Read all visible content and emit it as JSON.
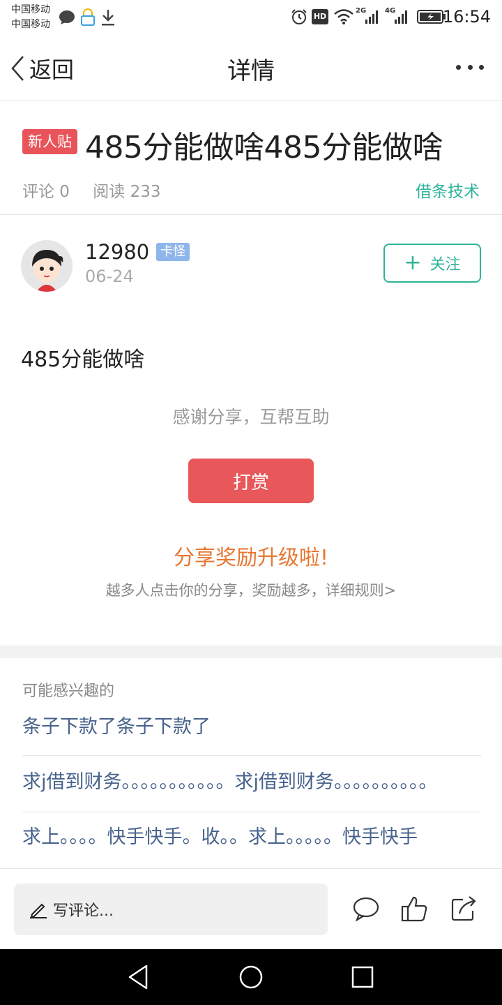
{
  "status_bar": {
    "carrier_1": "中国移动",
    "carrier_2": "中国移动",
    "signal_2g": "2G",
    "signal_4g": "4G",
    "hd_label": "HD",
    "time": "16:54"
  },
  "nav": {
    "back_label": "返回",
    "title": "详情"
  },
  "post": {
    "badge": "新人贴",
    "title": "485分能做啥485分能做啥",
    "comments_label": "评论 0",
    "reads_label": "阅读 233",
    "category": "借条技术",
    "author_name": "12980",
    "author_tag": "卡怪",
    "date": "06-24",
    "follow_plus": "+",
    "follow_label": "关注",
    "body": "485分能做啥",
    "thanks": "感谢分享，互帮互助",
    "reward_label": "打赏",
    "share_title": "分享奖励升级啦!",
    "share_desc": "越多人点击你的分享，奖励越多，详细规则>"
  },
  "related": {
    "header": "可能感兴趣的",
    "items": [
      "条子下款了条子下款了",
      "求j借到财务。。。。。。。。。。。求j借到财务。。。。。。。。。。",
      "求上。。。。快手快手。收。。求上。。。。。快手快手"
    ]
  },
  "bottom_bar": {
    "comment_placeholder": "写评论..."
  },
  "colors": {
    "accent_green": "#2fb39a",
    "badge_red": "#e8545a",
    "reward_red": "#e8575a",
    "share_orange": "#e87733",
    "link_blue": "#47628c",
    "tag_blue": "#8fb6ea"
  },
  "icons": [
    "message-icon",
    "lock-icon",
    "download-icon",
    "alarm-icon",
    "wifi-icon",
    "signal-icon",
    "battery-icon",
    "back-chevron-icon",
    "more-icon",
    "avatar",
    "pencil-icon",
    "comment-icon",
    "thumbs-up-icon",
    "share-icon",
    "android-back-icon",
    "android-home-icon",
    "android-recents-icon"
  ]
}
